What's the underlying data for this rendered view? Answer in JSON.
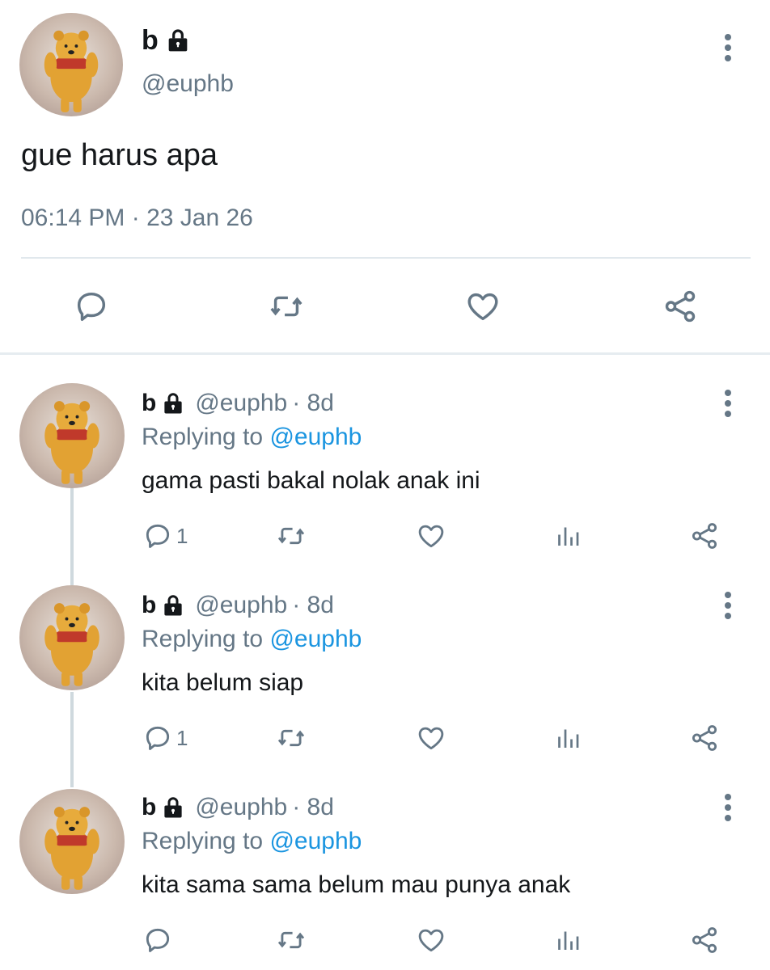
{
  "main_tweet": {
    "display_name": "b",
    "handle": "@euphb",
    "text": "gue harus apa",
    "timestamp": "06:14 PM · 23 Jan 26",
    "actions": [
      "reply-icon",
      "retweet-icon",
      "like-icon",
      "share-icon"
    ]
  },
  "replies": [
    {
      "display_name": "b",
      "handle": "@euphb",
      "age": "· 8d",
      "replying_label": "Replying to",
      "replying_to": "@euphb",
      "text": "gama pasti bakal nolak anak ini",
      "reply_count": "1"
    },
    {
      "display_name": "b",
      "handle": "@euphb",
      "age": "· 8d",
      "replying_label": "Replying to",
      "replying_to": "@euphb",
      "text": "kita belum siap",
      "reply_count": "1"
    },
    {
      "display_name": "b",
      "handle": "@euphb",
      "age": "· 8d",
      "replying_label": "Replying to",
      "replying_to": "@euphb",
      "text": "kita sama sama belum mau punya anak",
      "reply_count": ""
    }
  ],
  "colors": {
    "text_primary": "#14171a",
    "text_secondary": "#657786",
    "mention": "#1b95e0",
    "divider": "#e1e8ed"
  }
}
